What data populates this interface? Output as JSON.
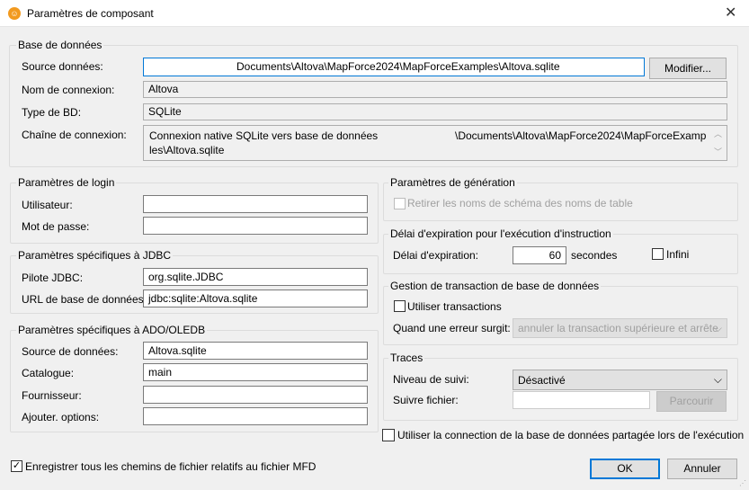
{
  "window": {
    "title": "Paramètres de composant",
    "close": "✕"
  },
  "database": {
    "legend": "Base de données",
    "source_label": "Source données:",
    "source_value": "Documents\\Altova\\MapForce2024\\MapForceExamples\\Altova.sqlite",
    "modify_button": "Modifier...",
    "conn_name_label": "Nom de connexion:",
    "conn_name_value": "Altova",
    "db_type_label": "Type de BD:",
    "db_type_value": "SQLite",
    "conn_string_label": "Chaîne de connexion:",
    "conn_string_line1_a": "Connexion native SQLite vers base de données",
    "conn_string_line1_b": "\\Documents\\Altova\\MapForce2024\\MapForceExamp",
    "conn_string_line2": "les\\Altova.sqlite"
  },
  "login": {
    "legend": "Paramètres de login",
    "user_label": "Utilisateur:",
    "user_value": "",
    "password_label": "Mot de passe:",
    "password_value": ""
  },
  "jdbc": {
    "legend": "Paramètres spécifiques à JDBC",
    "driver_label": "Pilote JDBC:",
    "driver_value": "org.sqlite.JDBC",
    "url_label": "URL de base de données:",
    "url_value": "jdbc:sqlite:Altova.sqlite"
  },
  "ado": {
    "legend": "Paramètres spécifiques à ADO/OLEDB",
    "source_label": "Source de données:",
    "source_value": "Altova.sqlite",
    "catalog_label": "Catalogue:",
    "catalog_value": "main",
    "provider_label": "Fournisseur:",
    "provider_value": "",
    "options_label": "Ajouter. options:",
    "options_value": ""
  },
  "generation": {
    "legend": "Paramètres de génération",
    "remove_schema_label": "Retirer les noms de schéma des noms de table",
    "remove_schema_checked": false
  },
  "timeout": {
    "legend": "Délai d'expiration pour l'exécution d'instruction",
    "label": "Délai d'expiration:",
    "value": "60",
    "unit": "secondes",
    "infinite_label": "Infini",
    "infinite_checked": false
  },
  "transaction": {
    "legend": "Gestion de transaction de base de données",
    "use_label": "Utiliser transactions",
    "use_checked": false,
    "on_error_label": "Quand une erreur surgit:",
    "on_error_value": "annuler la transaction supérieure et arrête"
  },
  "traces": {
    "legend": "Traces",
    "level_label": "Niveau de suivi:",
    "level_value": "Désactivé",
    "file_label": "Suivre fichier:",
    "file_value": "",
    "browse_button": "Parcourir"
  },
  "shared_conn": {
    "label": "Utiliser la connection de la base de données partagée lors de l'exécution",
    "checked": false
  },
  "relative_paths": {
    "label": "Enregistrer tous les chemins de fichier relatifs au fichier MFD",
    "checked": true
  },
  "buttons": {
    "ok": "OK",
    "cancel": "Annuler"
  }
}
